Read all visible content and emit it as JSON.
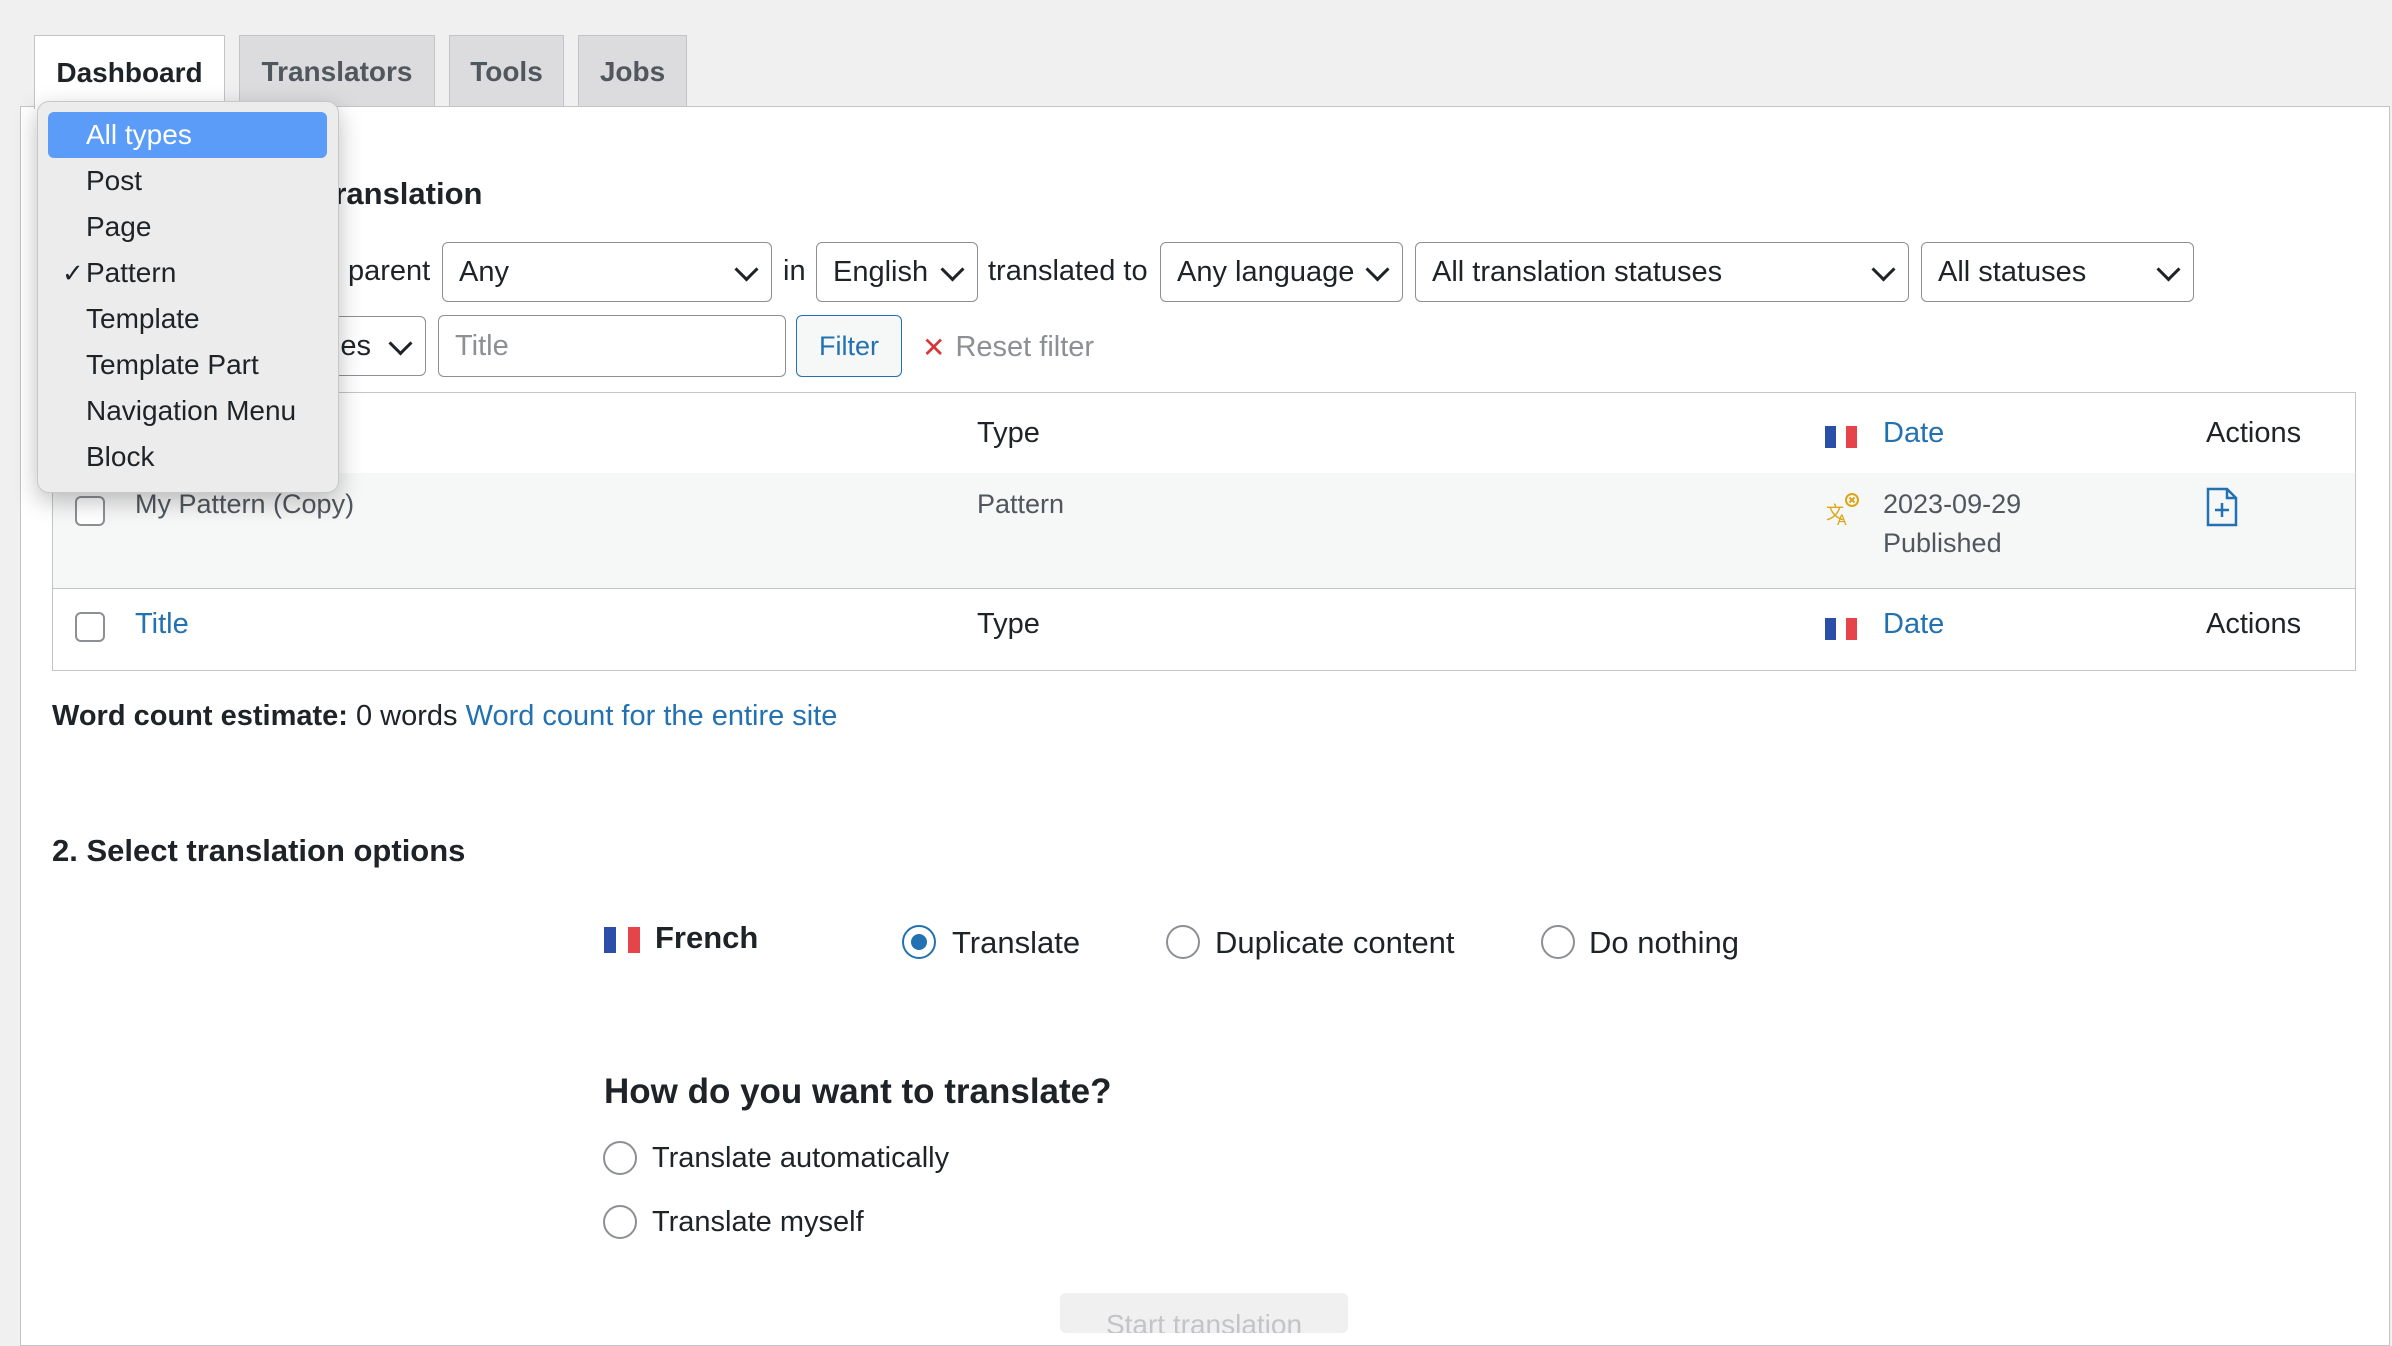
{
  "tabs": [
    "Dashboard",
    "Translators",
    "Tools",
    "Jobs"
  ],
  "section1": {
    "title_visible": "translation",
    "filters": {
      "parent_label": "parent",
      "parent_value": "Any",
      "in_label": "in",
      "language_value": "English",
      "translated_to_label": "translated to",
      "target_value": "Any language",
      "translation_status_value": "All translation statuses",
      "status_value": "All statuses",
      "priority_partial": "ies",
      "title_placeholder": "Title",
      "filter_button": "Filter",
      "reset_filter": "Reset filter"
    }
  },
  "table": {
    "headers": {
      "type": "Type",
      "date": "Date",
      "actions": "Actions"
    },
    "rows": [
      {
        "title": "My Pattern (Copy)",
        "type": "Pattern",
        "date": "2023-09-29",
        "status": "Published"
      }
    ],
    "footers": {
      "title": "Title",
      "type": "Type",
      "date": "Date",
      "actions": "Actions"
    }
  },
  "word_count": {
    "label": "Word count estimate:",
    "value": "0 words",
    "link": "Word count for the entire site"
  },
  "section2": {
    "title": "2. Select translation options",
    "language": "French",
    "options": [
      "Translate",
      "Duplicate content",
      "Do nothing"
    ],
    "selected_option": "Translate",
    "how_title": "How do you want to translate?",
    "how_options": [
      "Translate automatically",
      "Translate myself"
    ],
    "start_button": "Start translation"
  },
  "type_dropdown": {
    "items": [
      "All types",
      "Post",
      "Page",
      "Pattern",
      "Template",
      "Template Part",
      "Navigation Menu",
      "Block"
    ],
    "highlighted": "All types",
    "checked": "Pattern",
    "check_glyph": "✓"
  },
  "colors": {
    "link": "#2271b1",
    "flag_blue": "#2b4ea8",
    "flag_red": "#e5454a",
    "highlight": "#5b9cf8"
  }
}
